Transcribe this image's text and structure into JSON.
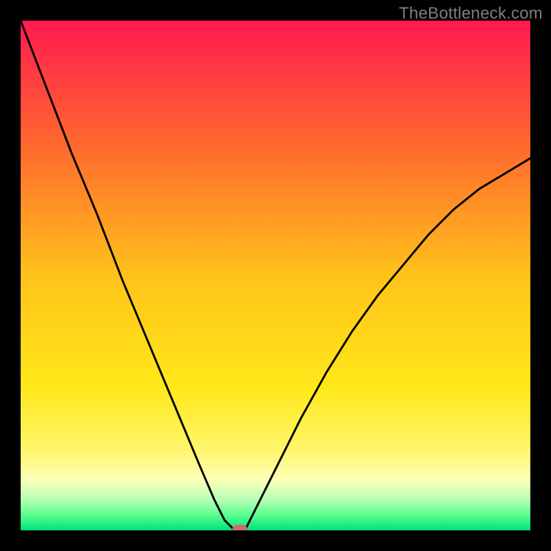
{
  "watermark": "TheBottleneck.com",
  "chart_data": {
    "type": "line",
    "title": "",
    "xlabel": "",
    "ylabel": "",
    "xlim": [
      0,
      100
    ],
    "ylim": [
      0,
      100
    ],
    "grid": false,
    "legend": false,
    "x": [
      0,
      5,
      10,
      15,
      20,
      25,
      30,
      35,
      38,
      40,
      41,
      42,
      43,
      44,
      45,
      50,
      55,
      60,
      65,
      70,
      75,
      80,
      85,
      90,
      95,
      100
    ],
    "values": [
      100,
      87,
      74,
      62,
      49,
      37,
      25,
      13,
      6,
      2,
      1,
      0,
      0,
      0,
      2,
      12,
      22,
      31,
      39,
      46,
      52,
      58,
      63,
      67,
      70,
      73
    ],
    "marker": {
      "x": 43,
      "y": 0,
      "color": "#d06a6a"
    },
    "gradient_stops": [
      {
        "pos": 0.0,
        "color": "#ff1a4f"
      },
      {
        "pos": 0.25,
        "color": "#ff6a2e"
      },
      {
        "pos": 0.5,
        "color": "#ffc21a"
      },
      {
        "pos": 0.72,
        "color": "#ffe81a"
      },
      {
        "pos": 0.84,
        "color": "#fff56a"
      },
      {
        "pos": 0.9,
        "color": "#fdffb6"
      },
      {
        "pos": 0.94,
        "color": "#b6ffb6"
      },
      {
        "pos": 0.97,
        "color": "#5aff8f"
      },
      {
        "pos": 1.0,
        "color": "#00e07a"
      }
    ]
  }
}
